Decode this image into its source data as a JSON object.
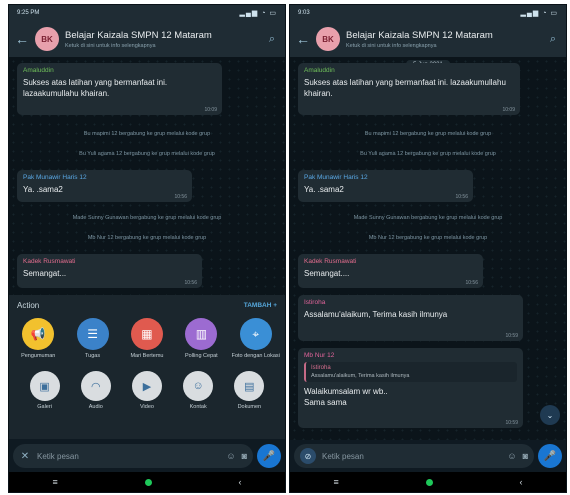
{
  "statusbar": {
    "left_time": "9:25 PM",
    "right_time": "9:03"
  },
  "group": {
    "avatar_initials": "BK",
    "title": "Belajar Kaizala SMPN 12 Mataram",
    "subtitle": "Ketuk di sini untuk info selengkapnya"
  },
  "left": {
    "messages": [
      {
        "sender": "Amaluddin",
        "text": "Sukses atas latihan yang bermanfaat ini. lazaakumullahu khairan.",
        "time": "10:09"
      },
      {
        "sender": "Pak Munawir Haris 12",
        "text": "Ya. .sama2",
        "time": "10:56"
      },
      {
        "sender": "Kadek Rusmawati",
        "text": "Semangat...",
        "time": "10:56"
      }
    ],
    "system": [
      "Bu mapimi 12 bergabung ke grup melalui kode grup",
      "Bu Yuli agama 12 bergabung ke grup melalui kode grup",
      "Made Sunny Gunawan bergabung ke grup melalui kode grup",
      "Mb Nur 12 bergabung ke grup melalui kode grup"
    ],
    "attach": {
      "title": "Action",
      "more": "TAMBAH +",
      "actions": [
        {
          "label": "Pengumuman",
          "icon": "megaphone-icon",
          "color": "#f2c12e"
        },
        {
          "label": "Tugas",
          "icon": "task-icon",
          "color": "#3b82c9"
        },
        {
          "label": "Mari Bertemu",
          "icon": "calendar-icon",
          "color": "#e05a4f"
        },
        {
          "label": "Polling Cepat",
          "icon": "poll-icon",
          "color": "#9c6bd1"
        },
        {
          "label": "Foto dengan Lokasi",
          "icon": "photo-location-icon",
          "color": "#3a8fd6"
        }
      ],
      "attachments": [
        {
          "label": "Galeri",
          "icon": "gallery-icon"
        },
        {
          "label": "Audio",
          "icon": "headphones-icon"
        },
        {
          "label": "Video",
          "icon": "video-icon"
        },
        {
          "label": "Kontak",
          "icon": "contact-icon"
        },
        {
          "label": "Dokumen",
          "icon": "document-icon"
        }
      ]
    },
    "input_placeholder": "Ketik pesan"
  },
  "right": {
    "date_chip": "5 Jun 2021",
    "messages": [
      {
        "sender": "Amaluddin",
        "text": "Sukses atas latihan yang bermanfaat ini. lazaakumullahu khairan.",
        "time": "10:09"
      },
      {
        "sender": "Pak Munawir Haris 12",
        "text": "Ya. .sama2",
        "time": "10:56"
      },
      {
        "sender": "Kadek Rusmawati",
        "text": "Semangat....",
        "time": "10:56"
      },
      {
        "sender": "Istiroha",
        "text": "Assalamu'alaikum, Terima kasih ilmunya",
        "time": "10:59"
      },
      {
        "sender": "Mb Nur 12",
        "quote_name": "Istiroha",
        "quote_text": "Assalamu'alaikum, Terima kasih ilmunya",
        "text": "Walaikumsalam  wr  wb..\nSama sama",
        "time": "10:59"
      }
    ],
    "system": [
      "Bu mapimi 12 bergabung ke grup melalui kode grup",
      "Bu Yuli agama 12 bergabung ke grup melalui kode grup",
      "Made Sunny Gunawan bergabung ke grup melalui kode grup",
      "Mb Nur 12 bergabung ke grup melalui kode grup"
    ],
    "input_placeholder": "Ketik pesan"
  },
  "colors": {
    "accent": "#1976d2",
    "sender_amaluddin": "#6fbf5a",
    "sender_munawir": "#5aa9e6",
    "sender_kadek": "#e36d8e",
    "sender_istiroha": "#e0649a",
    "sender_mbnur": "#e0649a"
  }
}
